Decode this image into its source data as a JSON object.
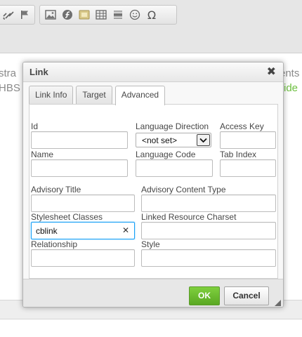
{
  "editor": {
    "toolbar_icons": [
      "unlink-icon",
      "anchor-flag-icon",
      "image-icon",
      "flash-icon",
      "iframe-icon",
      "table-icon",
      "horizontal-rule-icon",
      "smiley-icon",
      "special-char-icon"
    ],
    "special_char_glyph": "Ω",
    "text_left_1": "stra",
    "text_left_2": "HBS",
    "text_right_1": "ents",
    "text_right_2": "ide",
    "link_color": "#6cbf3f"
  },
  "dialog": {
    "title": "Link",
    "close_glyph": "✖",
    "tabs": [
      {
        "label": "Link Info",
        "active": false
      },
      {
        "label": "Target",
        "active": false
      },
      {
        "label": "Advanced",
        "active": true
      }
    ],
    "fields": {
      "id": {
        "label": "Id",
        "value": ""
      },
      "language_direction": {
        "label": "Language Direction",
        "value": "<not set>"
      },
      "access_key": {
        "label": "Access Key",
        "value": ""
      },
      "name": {
        "label": "Name",
        "value": ""
      },
      "language_code": {
        "label": "Language Code",
        "value": ""
      },
      "tab_index": {
        "label": "Tab Index",
        "value": ""
      },
      "advisory_title": {
        "label": "Advisory Title",
        "value": ""
      },
      "advisory_content_type": {
        "label": "Advisory Content Type",
        "value": ""
      },
      "stylesheet_classes": {
        "label": "Stylesheet Classes",
        "value": "cblink",
        "clear_glyph": "✕"
      },
      "linked_resource_charset": {
        "label": "Linked Resource Charset",
        "value": ""
      },
      "relationship": {
        "label": "Relationship",
        "value": ""
      },
      "style": {
        "label": "Style",
        "value": ""
      }
    },
    "buttons": {
      "ok_label": "OK",
      "cancel_label": "Cancel"
    },
    "colors": {
      "ok_button": "#6bbf31",
      "focus_border": "#139ff7"
    }
  }
}
